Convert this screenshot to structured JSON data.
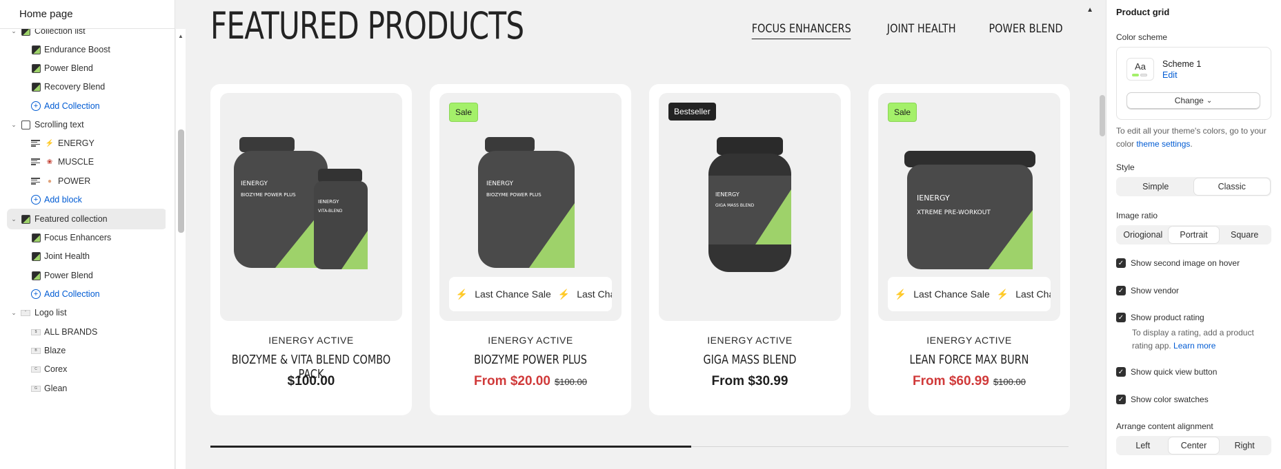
{
  "left_panel": {
    "title": "Home page",
    "items": [
      {
        "label": "Collection list",
        "kind": "section"
      },
      {
        "label": "Endurance Boost",
        "kind": "child"
      },
      {
        "label": "Power Blend",
        "kind": "child"
      },
      {
        "label": "Recovery Blend",
        "kind": "child"
      },
      {
        "label": "Add Collection",
        "kind": "add"
      },
      {
        "label": "Scrolling text",
        "kind": "section"
      },
      {
        "label": "ENERGY",
        "kind": "text-child"
      },
      {
        "label": "MUSCLE",
        "kind": "text-child"
      },
      {
        "label": "POWER",
        "kind": "text-child"
      },
      {
        "label": "Add block",
        "kind": "add"
      },
      {
        "label": "Featured collection",
        "kind": "section-selected"
      },
      {
        "label": "Focus Enhancers",
        "kind": "child"
      },
      {
        "label": "Joint Health",
        "kind": "child"
      },
      {
        "label": "Power Blend",
        "kind": "child"
      },
      {
        "label": "Add Collection",
        "kind": "add"
      },
      {
        "label": "Logo list",
        "kind": "section"
      },
      {
        "label": "ALL BRANDS",
        "kind": "logo-child"
      },
      {
        "label": "Blaze",
        "kind": "logo-child"
      },
      {
        "label": "Corex",
        "kind": "logo-child"
      },
      {
        "label": "Glean",
        "kind": "logo-child"
      }
    ]
  },
  "preview": {
    "heading": "FEATURED PRODUCTS",
    "tabs": [
      "FOCUS ENHANCERS",
      "JOINT HEALTH",
      "POWER BLEND"
    ],
    "active_tab": "FOCUS ENHANCERS",
    "marquee_text": "Last Chance Sale",
    "products": [
      {
        "badge": "",
        "vendor": "IENERGY ACTIVE",
        "name": "BIOZYME & VITA BLEND COMBO PACK",
        "price": "$100.00",
        "compare": "",
        "on_sale": false,
        "marquee": false
      },
      {
        "badge": "Sale",
        "vendor": "IENERGY ACTIVE",
        "name": "BIOZYME POWER PLUS",
        "price": "From $20.00",
        "compare": "$100.00",
        "on_sale": true,
        "marquee": true
      },
      {
        "badge": "Bestseller",
        "vendor": "IENERGY ACTIVE",
        "name": "GIGA MASS BLEND",
        "price": "From $30.99",
        "compare": "",
        "on_sale": false,
        "marquee": false
      },
      {
        "badge": "Sale",
        "vendor": "IENERGY ACTIVE",
        "name": "LEAN FORCE MAX BURN",
        "price": "From $60.99",
        "compare": "$100.00",
        "on_sale": true,
        "marquee": true
      }
    ],
    "product_labels": [
      {
        "brand": "IENERGY",
        "line1": "BIOZYME POWER PLUS",
        "line2": "VITA-BLEND"
      },
      {
        "brand": "IENERGY",
        "line1": "BIOZYME POWER PLUS"
      },
      {
        "brand": "IENERGY",
        "line1": "GIGA MASS BLEND"
      },
      {
        "brand": "IENERGY",
        "line1": "XTREME PRE-WORKOUT"
      }
    ],
    "scroll_progress": 0.56
  },
  "right_panel": {
    "title": "Product grid",
    "color_scheme_label": "Color scheme",
    "scheme_swatch": "Aa",
    "scheme_name": "Scheme 1",
    "edit_link": "Edit",
    "change_button": "Change",
    "help_text_prefix": "To edit all your theme's colors, go to your color ",
    "help_link": "theme settings",
    "help_suffix": ".",
    "style_label": "Style",
    "style_options": [
      "Simple",
      "Classic"
    ],
    "style_selected": "Classic",
    "ratio_label": "Image ratio",
    "ratio_options": [
      "Oriogional",
      "Portrait",
      "Square"
    ],
    "ratio_selected": "Portrait",
    "checkboxes": [
      {
        "label": "Show second image on hover",
        "checked": true
      },
      {
        "label": "Show vendor",
        "checked": true
      },
      {
        "label": "Show product rating",
        "checked": true
      },
      {
        "label": "Show quick view button",
        "checked": true
      },
      {
        "label": "Show color swatches",
        "checked": true
      }
    ],
    "rating_help_prefix": "To display a rating, add a product rating app. ",
    "rating_help_link": "Learn more",
    "align_label": "Arrange content alignment",
    "align_options": [
      "Left",
      "Center",
      "Right"
    ],
    "align_selected": "Center",
    "colors": {
      "accent": "#a4f06a",
      "link": "#005bd3",
      "sale_price": "#d03a3a"
    }
  }
}
